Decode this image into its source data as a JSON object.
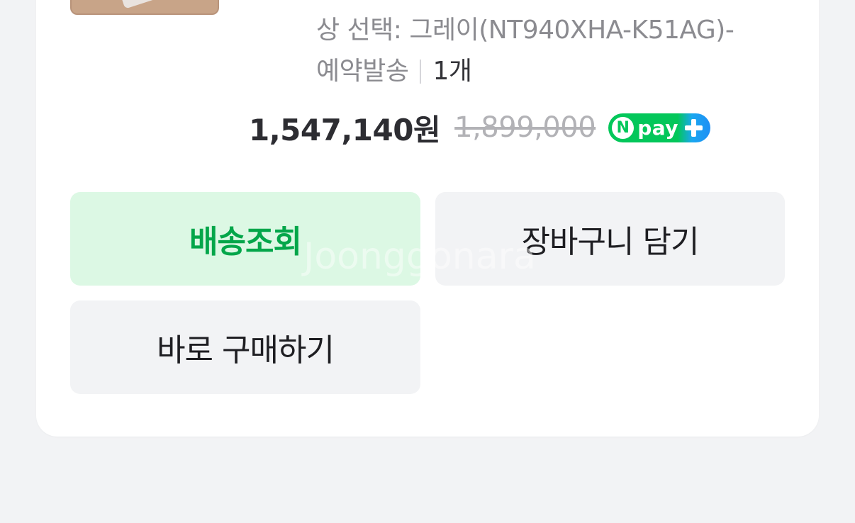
{
  "product": {
    "option_line1": "상 선택: 그레이(NT940XHA-K51AG)-",
    "option_line2": "예약발송",
    "quantity": "1개"
  },
  "pricing": {
    "price": "1,547,140원",
    "original_price": "1,899,000",
    "npay_n": "N",
    "npay_label": "pay"
  },
  "actions": {
    "track_delivery": "배송조회",
    "add_to_cart": "장바구니 담기",
    "buy_now": "바로 구매하기"
  },
  "watermark": "Joonggonara",
  "colors": {
    "accent_green": "#03a64a",
    "accent_green_bg": "#dcf8e4",
    "npay_green": "#03c75a",
    "npay_blue": "#1e8ff5"
  }
}
